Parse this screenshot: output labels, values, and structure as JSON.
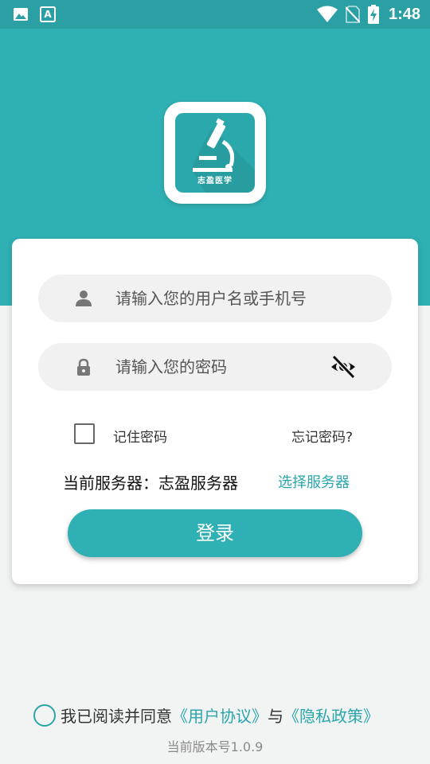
{
  "status_bar": {
    "time": "1:48",
    "icons": [
      "image-icon",
      "text-recognition-icon",
      "wifi-icon",
      "no-sim-icon",
      "battery-charging-icon"
    ]
  },
  "logo": {
    "text": "志盈医学",
    "icon": "microscope-icon"
  },
  "login_form": {
    "username_placeholder": "请输入您的用户名或手机号",
    "password_placeholder": "请输入您的密码",
    "remember_label": "记住密码",
    "remember_checked": false,
    "forgot_label": "忘记密码?",
    "server_label": "当前服务器：志盈服务器",
    "choose_server_label": "选择服务器",
    "login_label": "登录"
  },
  "footer": {
    "agree_prefix": "我已阅读并同意",
    "user_agreement": "《用户协议》",
    "conjunction": "与",
    "privacy_policy": "《隐私政策》",
    "agreed": false,
    "version": "当前版本号1.0.9"
  },
  "colors": {
    "primary": "#2fb0b4",
    "status_bar": "#2a9fa4",
    "link": "#2aa6ab",
    "background": "#f2f3f3"
  }
}
